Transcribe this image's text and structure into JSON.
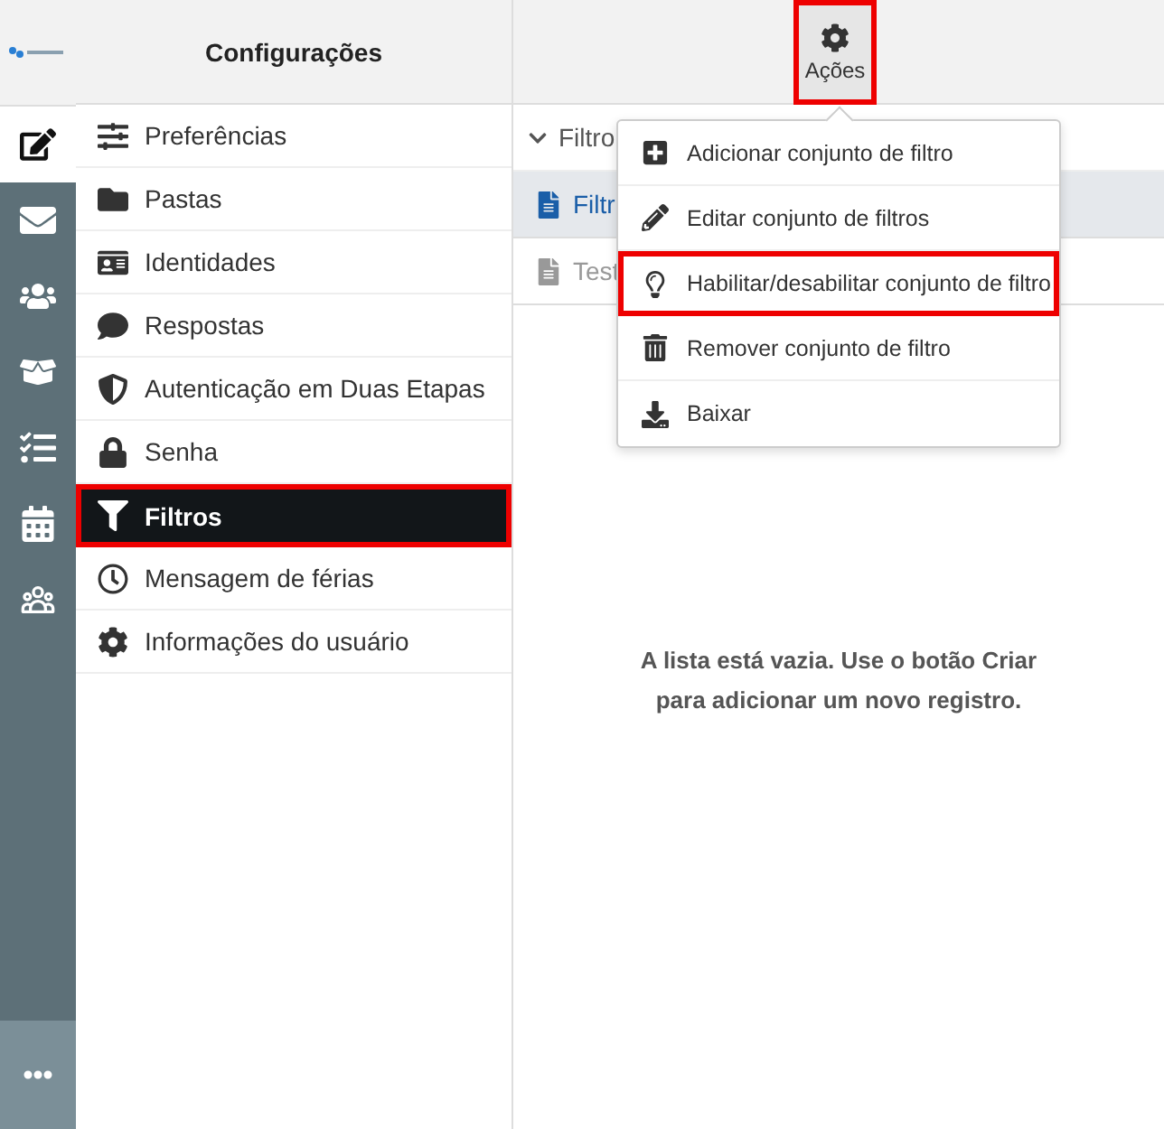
{
  "rail": [
    {
      "selected": true
    },
    {
      "selected": false
    },
    {
      "selected": false
    },
    {
      "selected": false
    },
    {
      "selected": false
    },
    {
      "selected": false
    },
    {
      "selected": false
    }
  ],
  "settings": {
    "title": "Configurações",
    "items": [
      {
        "label": "Preferências",
        "selected": false,
        "highlighted": false
      },
      {
        "label": "Pastas",
        "selected": false,
        "highlighted": false
      },
      {
        "label": "Identidades",
        "selected": false,
        "highlighted": false
      },
      {
        "label": "Respostas",
        "selected": false,
        "highlighted": false
      },
      {
        "label": "Autenticação em Duas Etapas",
        "selected": false,
        "highlighted": false
      },
      {
        "label": "Senha",
        "selected": false,
        "highlighted": false
      },
      {
        "label": "Filtros",
        "selected": true,
        "highlighted": true
      },
      {
        "label": "Mensagem de férias",
        "selected": false,
        "highlighted": false
      },
      {
        "label": "Informações do usuário",
        "selected": false,
        "highlighted": false
      }
    ]
  },
  "actions_button": {
    "label": "Ações",
    "highlighted": true
  },
  "filter_group": {
    "label": "Filtro",
    "expanded": true,
    "items": [
      {
        "label": "Filtr",
        "selected": true,
        "disabled": false
      },
      {
        "label": "Test",
        "selected": false,
        "disabled": true
      }
    ]
  },
  "actions_menu": [
    {
      "label": "Adicionar conjunto de filtro",
      "highlighted": false
    },
    {
      "label": "Editar conjunto de filtros",
      "highlighted": false
    },
    {
      "label": "Habilitar/desabilitar conjunto de filtro",
      "highlighted": true
    },
    {
      "label": "Remover conjunto de filtro",
      "highlighted": false
    },
    {
      "label": "Baixar",
      "highlighted": false
    }
  ],
  "empty_message": "A lista está vazia. Use o botão Criar para adicionar um novo registro."
}
